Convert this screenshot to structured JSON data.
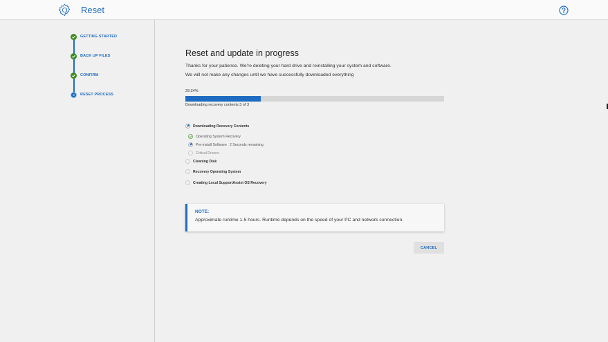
{
  "app": {
    "title": "Reset",
    "icon": "gear-icon",
    "help_icon": "question-circle-icon",
    "accent_color": "#1e6cc1",
    "success_color": "#3d8b25"
  },
  "steps": [
    {
      "label": "GETTING STARTED",
      "status": "complete"
    },
    {
      "label": "BACK UP FILES",
      "status": "complete"
    },
    {
      "label": "CONFIRM",
      "status": "complete"
    },
    {
      "label": "RESET PROCESS",
      "status": "current",
      "number": "4"
    }
  ],
  "main": {
    "title": "Reset and update in progress",
    "description_1": "Thanks for your patience. We're deleting your hard drive and reinstalling your system and software.",
    "description_2": "We will not make any changes until we have successfully downloaded everything",
    "progress": {
      "percent_label": "29.24%",
      "value": 29.24,
      "status": "Downloading recovery contents 3 of 3"
    },
    "tasks": [
      {
        "label": "Downloading Recovery Contents",
        "level": "major",
        "state": "in-progress"
      },
      {
        "label": "Operating System Recovery",
        "level": "sub",
        "state": "done"
      },
      {
        "label": "Pre-install Software",
        "level": "sub",
        "state": "in-progress",
        "extra": "2 Seconds remaining"
      },
      {
        "label": "Critical Drivers",
        "level": "sub",
        "state": "pending"
      },
      {
        "label": "Cleaning Disk",
        "level": "major",
        "state": "pending"
      },
      {
        "label": "Recovery Operating System",
        "level": "major",
        "state": "pending"
      },
      {
        "label": "Creating Local SupportAssist OS Recovery",
        "level": "major",
        "state": "pending"
      }
    ]
  },
  "note": {
    "title": "NOTE:",
    "text": "Approximate runtime 1-5 hours. Runtime depends on the speed of your PC and network connection."
  },
  "actions": {
    "cancel_label": "CANCEL"
  }
}
